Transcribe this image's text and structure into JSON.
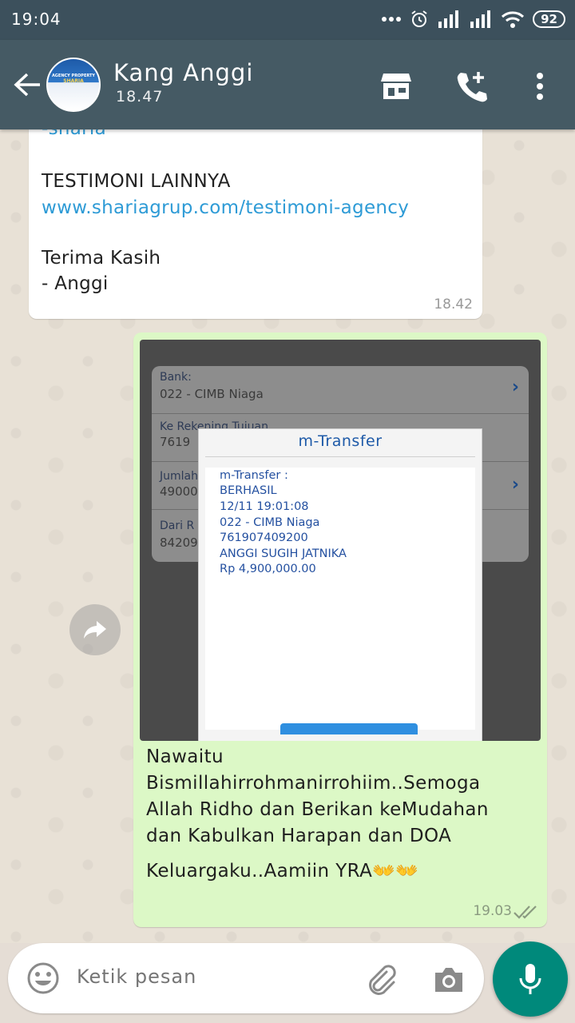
{
  "status_bar": {
    "time": "19:04",
    "battery": "92"
  },
  "header": {
    "contact_name": "Kang Anggi",
    "status": "18.47",
    "avatar_line1": "AGENCY PROPERTY",
    "avatar_line2": "SHARIA"
  },
  "incoming_message": {
    "lines": [
      "-sharia",
      "TESTIMONI LAINNYA",
      "www.shariagrup.com/testimoni-agency",
      "Terima Kasih",
      "- Anggi"
    ],
    "time": "18.42"
  },
  "outgoing_message": {
    "photo": {
      "bank_label": "Bank:",
      "bank_value": "022 - CIMB Niaga",
      "rekening_label": "Ke Rekening Tujuan",
      "rekening_value": "7619",
      "jumlah_label": "Jumlah",
      "jumlah_value": "49000",
      "dari_label": "Dari R",
      "dari_value": "84209",
      "dialog_title": "m-Transfer",
      "dialog_lines": [
        "m-Transfer :",
        "BERHASIL",
        "12/11 19:01:08",
        "022 - CIMB Niaga",
        "761907409200",
        "ANGGI SUGIH JATNIKA",
        "Rp 4,900,000.00"
      ]
    },
    "caption_lines": [
      "Nawaitu",
      "Bismillahirrohmanirrohiim..Semoga",
      "Allah Ridho dan Berikan  keMudahan",
      "dan Kabulkan Harapan dan DOA",
      "Keluargaku..Aamiin YRA👐👐"
    ],
    "time": "19.03"
  },
  "input": {
    "placeholder": "Ketik pesan"
  },
  "colors": {
    "header": "#455a64",
    "outgoing_bubble": "#dcf8c6",
    "link": "#2e9bd6",
    "mic": "#00897b"
  }
}
